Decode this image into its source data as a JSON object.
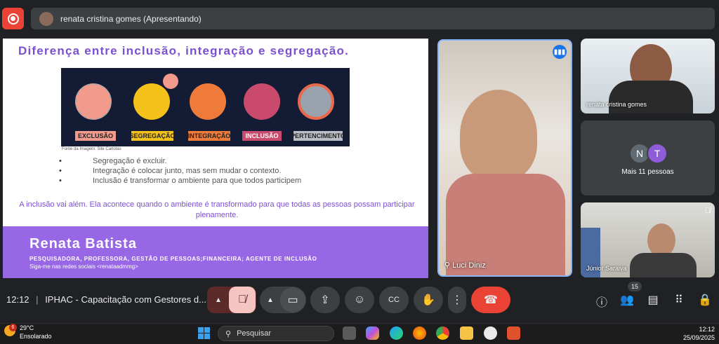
{
  "presenting_bar": {
    "text": "renata cristina gomes (Apresentando)"
  },
  "slide": {
    "title": "Diferença entre inclusão, integração e segregação.",
    "banner_labels": [
      "EXCLUSÃO",
      "SEGREGAÇÃO",
      "INTEGRAÇÃO",
      "INCLUSÃO",
      "PERTENCIMENTO"
    ],
    "image_credit": "Fonte da Imagem: Site Carlotas",
    "bullets": [
      "Segregação é excluir.",
      "Integração é colocar junto, mas sem mudar o contexto.",
      "Inclusão é transformar o ambiente para que todos participem"
    ],
    "paragraph": "A inclusão vai além. Ela acontece quando o ambiente é transformado para que todas as pessoas possam participar plenamente.",
    "footer": {
      "name": "Renata Batista",
      "roles": "PESQUISADORA, PROFESSORA, GESTÃO DE PESSOAS;FINANCEIRA; AGENTE DE INCLUSÃO",
      "social": "Siga-me nas redes sociais <renataadmmg>"
    }
  },
  "participants": {
    "main_tile": {
      "name": "Luci Diniz"
    },
    "renata_tile": {
      "name": "renata cristina gomes"
    },
    "more_tile": {
      "initials": [
        "N",
        "T"
      ],
      "label": "Mais 11 pessoas"
    },
    "junior_tile": {
      "name": "Júnior Saraiva"
    }
  },
  "meeting": {
    "time": "12:12",
    "separator": "|",
    "title": "IPHAC - Capacitação com Gestores d..."
  },
  "people_count": "15",
  "taskbar": {
    "weather_temp": "29°C",
    "weather_desc": "Ensolarado",
    "weather_badge": "6",
    "search_placeholder": "Pesquisar",
    "time": "12:12",
    "date": "25/09/2025"
  },
  "colors": {
    "accent": "#7b4fd1",
    "footer": "#9867e6",
    "hangup": "#ea4335",
    "mic_off": "#5c2b29"
  }
}
